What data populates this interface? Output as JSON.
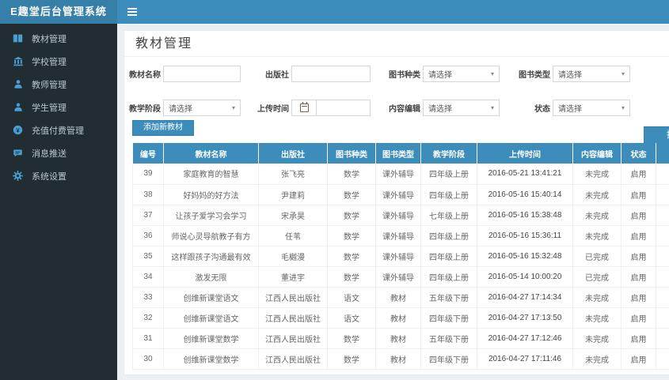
{
  "app": {
    "title": "E趣堂后台管理系统"
  },
  "page": {
    "title": "教材管理"
  },
  "colors": {
    "navbar": "#3c8dbc",
    "logo_bg": "#367fa9",
    "sidebar_bg": "#222d32",
    "sidebar_text": "#b8c7ce",
    "sidebar_icon": "#459fd4",
    "accent": "#3c8dbc",
    "content_bg": "#ecf0f5"
  },
  "sidebar": {
    "items": [
      {
        "key": "textbooks",
        "label": "教材管理",
        "icon": "book"
      },
      {
        "key": "schools",
        "label": "学校管理",
        "icon": "bank"
      },
      {
        "key": "teachers",
        "label": "教师管理",
        "icon": "teacher"
      },
      {
        "key": "students",
        "label": "学生管理",
        "icon": "student"
      },
      {
        "key": "payments",
        "label": "充值付费管理",
        "icon": "payment"
      },
      {
        "key": "messages",
        "label": "消息推送",
        "icon": "message"
      },
      {
        "key": "settings",
        "label": "系统设置",
        "icon": "gear"
      }
    ]
  },
  "filters": {
    "fields": [
      {
        "label": "教材名称",
        "type": "text",
        "value": ""
      },
      {
        "label": "出版社",
        "type": "text",
        "value": ""
      },
      {
        "label": "图书种类",
        "type": "select",
        "value": "请选择"
      },
      {
        "label": "图书类型",
        "type": "select",
        "value": "请选择"
      },
      {
        "label": "教学阶段",
        "type": "select",
        "value": "请选择"
      },
      {
        "label": "上传时间",
        "type": "date",
        "value": ""
      },
      {
        "label": "内容编辑",
        "type": "select",
        "value": "请选择"
      },
      {
        "label": "状态",
        "type": "select",
        "value": "请选择"
      }
    ],
    "search_label": "搜索"
  },
  "toolbar": {
    "add_label": "添加新教材"
  },
  "table": {
    "columns": [
      "编号",
      "教材名称",
      "出版社",
      "图书种类",
      "图书类型",
      "教学阶段",
      "上传时间",
      "内容编辑",
      "状态",
      ""
    ],
    "rows": [
      [
        "39",
        "家庭教育的智慧",
        "张飞亮",
        "数学",
        "课外辅导",
        "四年级上册",
        "2016-05-21 13:41:21",
        "未完成",
        "启用"
      ],
      [
        "38",
        "好妈妈的好方法",
        "尹建莉",
        "数学",
        "课外辅导",
        "四年级上册",
        "2016-05-16 15:40:14",
        "未完成",
        "启用"
      ],
      [
        "37",
        "让孩子爱学习会学习",
        "宋承昊",
        "数学",
        "课外辅导",
        "七年级上册",
        "2016-05-16 15:38:48",
        "未完成",
        "启用"
      ],
      [
        "36",
        "师说心灵导航教子有方",
        "任苇",
        "数学",
        "课外辅导",
        "四年级上册",
        "2016-05-16 15:36:11",
        "未完成",
        "启用"
      ],
      [
        "35",
        "这样跟孩子沟通最有效",
        "毛樾漫",
        "数学",
        "课外辅导",
        "四年级上册",
        "2016-05-16 15:32:48",
        "已完成",
        "启用"
      ],
      [
        "34",
        "激发无限",
        "董进宇",
        "数学",
        "课外辅导",
        "四年级上册",
        "2016-05-14 10:00:20",
        "已完成",
        "启用"
      ],
      [
        "33",
        "创维新课堂语文",
        "江西人民出版社",
        "语文",
        "教材",
        "五年级下册",
        "2016-04-27 17:14:34",
        "未完成",
        "启用"
      ],
      [
        "32",
        "创维新课堂语文",
        "江西人民出版社",
        "语文",
        "教材",
        "四年级下册",
        "2016-04-27 17:13:50",
        "未完成",
        "启用"
      ],
      [
        "31",
        "创维新课堂数学",
        "江西人民出版社",
        "数学",
        "教材",
        "五年级下册",
        "2016-04-27 17:12:46",
        "未完成",
        "启用"
      ],
      [
        "30",
        "创维新课堂数学",
        "江西人民出版社",
        "数学",
        "教材",
        "四年级下册",
        "2016-04-27 17:11:46",
        "未完成",
        "启用"
      ]
    ]
  }
}
